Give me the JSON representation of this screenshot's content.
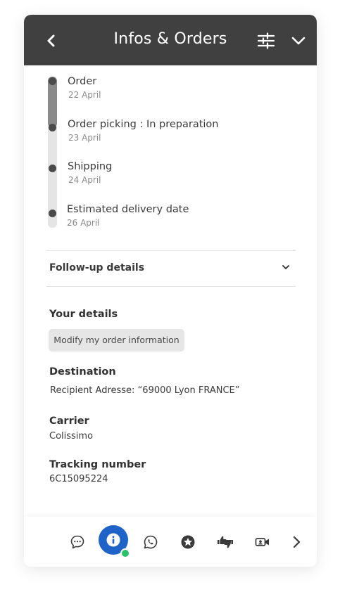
{
  "header": {
    "title": "Infos & Orders"
  },
  "timeline": [
    {
      "label": "Order",
      "date": "22 April"
    },
    {
      "label": "Order picking : In preparation",
      "date": "23 April"
    },
    {
      "label": "Shipping",
      "date": "24 April"
    },
    {
      "label": "Estimated delivery date",
      "date": "26 April"
    }
  ],
  "followup": {
    "label": "Follow-up details"
  },
  "details": {
    "title": "Your details",
    "modify_label": "Modify my order information",
    "destination_title": "Destination",
    "destination_value": "Recipient  Adresse: “69000 Lyon FRANCE”",
    "carrier_title": "Carrier",
    "carrier_value": "Colissimo",
    "tracking_title": "Tracking number",
    "tracking_value": "6C15095224"
  },
  "colors": {
    "header_bg": "#404040",
    "accent": "#1e63c8",
    "online": "#29c36a"
  },
  "icons": {
    "header": [
      "chevron-left-icon",
      "sliders-icon",
      "chevron-down-icon"
    ],
    "bottombar": [
      "chat-bubble-icon",
      "info-icon",
      "whatsapp-icon",
      "star-icon",
      "thumbs-up-down-icon",
      "video-call-icon",
      "chevron-right-icon"
    ]
  }
}
